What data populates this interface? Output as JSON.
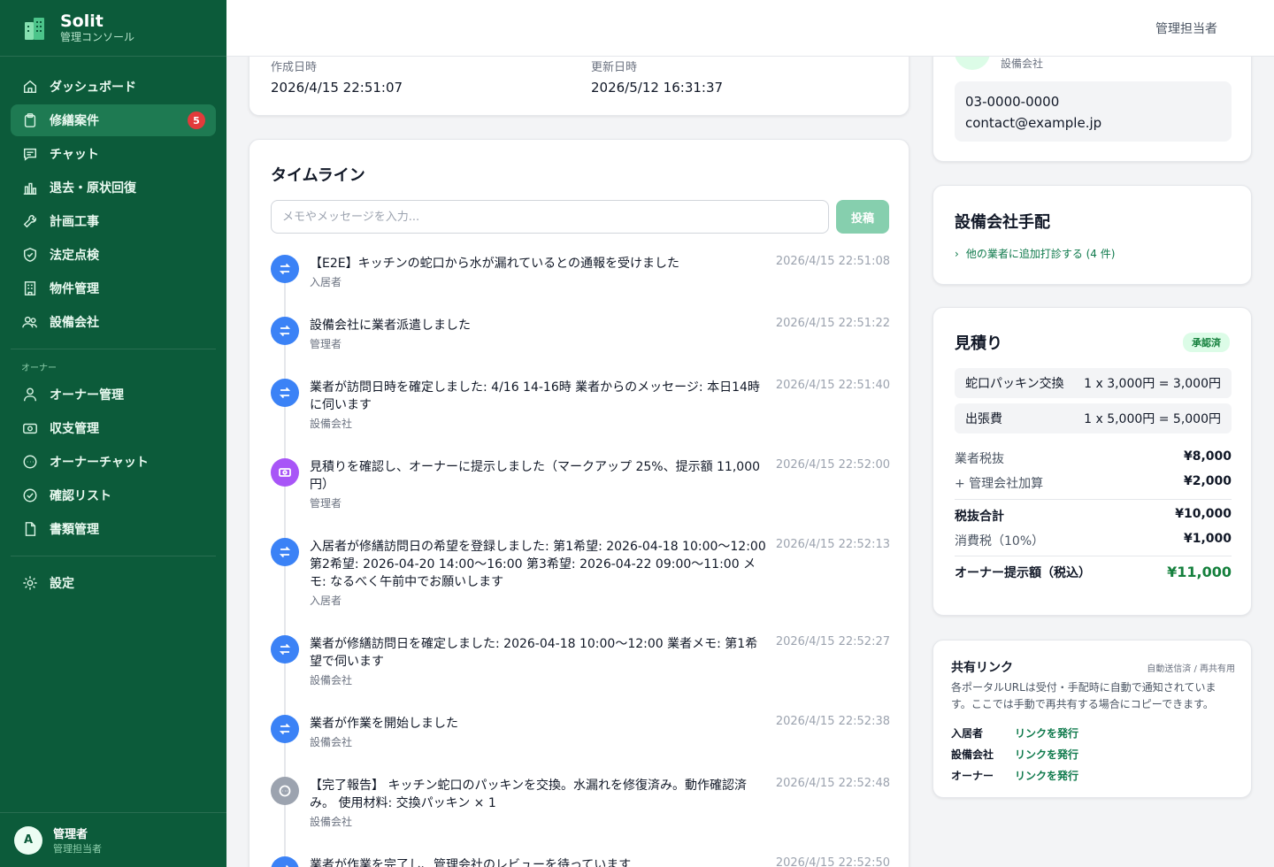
{
  "brand": {
    "title": "Solit",
    "subtitle": "管理コンソール"
  },
  "nav": {
    "items": [
      {
        "label": "ダッシュボード",
        "icon": "home-icon"
      },
      {
        "label": "修繕案件",
        "icon": "clipboard-icon",
        "badge": "5",
        "active": true
      },
      {
        "label": "チャット",
        "icon": "chat-icon"
      },
      {
        "label": "退去・原状回復",
        "icon": "building-chart-icon"
      },
      {
        "label": "計画工事",
        "icon": "wrench-icon"
      },
      {
        "label": "法定点検",
        "icon": "shield-check-icon"
      },
      {
        "label": "物件管理",
        "icon": "building-icon"
      },
      {
        "label": "設備会社",
        "icon": "users-icon"
      }
    ],
    "owner_section": "オーナー",
    "owner_items": [
      {
        "label": "オーナー管理",
        "icon": "user-icon"
      },
      {
        "label": "収支管理",
        "icon": "money-icon"
      },
      {
        "label": "オーナーチャット",
        "icon": "chat-dots-icon"
      },
      {
        "label": "確認リスト",
        "icon": "check-circle-icon"
      },
      {
        "label": "書類管理",
        "icon": "document-icon"
      }
    ],
    "settings": {
      "label": "設定",
      "icon": "gear-icon"
    }
  },
  "user": {
    "initial": "A",
    "name": "管理者",
    "role": "管理担当者"
  },
  "header": {
    "user_label": "管理担当者"
  },
  "dates": {
    "created_label": "作成日時",
    "created_value": "2026/4/15 22:51:07",
    "updated_label": "更新日時",
    "updated_value": "2026/5/12 16:31:37"
  },
  "timeline": {
    "title": "タイムライン",
    "input_placeholder": "メモやメッセージを入力...",
    "post_label": "投稿",
    "items": [
      {
        "text": "【E2E】キッチンの蛇口から水が漏れているとの通報を受けました",
        "actor": "入居者",
        "time": "2026/4/15 22:51:08",
        "kind": "blue",
        "icon": "swap-icon"
      },
      {
        "text": "設備会社に業者派遣しました",
        "actor": "管理者",
        "time": "2026/4/15 22:51:22",
        "kind": "blue",
        "icon": "swap-icon"
      },
      {
        "text": "業者が訪問日時を確定しました: 4/16 14-16時 業者からのメッセージ: 本日14時に伺います",
        "actor": "設備会社",
        "time": "2026/4/15 22:51:40",
        "kind": "blue",
        "icon": "swap-icon"
      },
      {
        "text": "見積りを確認し、オーナーに提示しました（マークアップ 25%、提示額 11,000円）",
        "actor": "管理者",
        "time": "2026/4/15 22:52:00",
        "kind": "purple",
        "icon": "money-icon"
      },
      {
        "text": "入居者が修繕訪問日の希望を登録しました: 第1希望: 2026-04-18 10:00〜12:00 第2希望: 2026-04-20 14:00〜16:00 第3希望: 2026-04-22 09:00〜11:00 メモ: なるべく午前中でお願いします",
        "actor": "入居者",
        "time": "2026/4/15 22:52:13",
        "kind": "blue",
        "icon": "swap-icon"
      },
      {
        "text": "業者が修繕訪問日を確定しました: 2026-04-18 10:00〜12:00 業者メモ: 第1希望で伺います",
        "actor": "設備会社",
        "time": "2026/4/15 22:52:27",
        "kind": "blue",
        "icon": "swap-icon"
      },
      {
        "text": "業者が作業を開始しました",
        "actor": "設備会社",
        "time": "2026/4/15 22:52:38",
        "kind": "blue",
        "icon": "swap-icon"
      },
      {
        "text": "【完了報告】 キッチン蛇口のパッキンを交換。水漏れを修復済み。動作確認済み。 使用材料: 交換パッキン × 1",
        "actor": "設備会社",
        "time": "2026/4/15 22:52:48",
        "kind": "gray",
        "icon": "chat-dots-icon"
      },
      {
        "text": "業者が作業を完了し、管理会社のレビューを待っています",
        "actor": "",
        "time": "2026/4/15 22:52:50",
        "kind": "blue",
        "icon": "swap-icon"
      }
    ]
  },
  "vendor": {
    "subtitle": "設備会社",
    "phone": "03-0000-0000",
    "email": "contact@example.jp"
  },
  "dispatch": {
    "title": "設備会社手配",
    "link": "他の業者に追加打診する (4 件)"
  },
  "estimate": {
    "title": "見積り",
    "status": "承認済",
    "lines": [
      {
        "name": "蛇口パッキン交換",
        "calc": "1 x 3,000円 = 3,000円"
      },
      {
        "name": "出張費",
        "calc": "1 x 5,000円 = 5,000円"
      }
    ],
    "vendor_pre_tax_label": "業者税抜",
    "vendor_pre_tax": "¥8,000",
    "markup_label": "+ 管理会社加算",
    "markup": "¥2,000",
    "subtotal_label": "税抜合計",
    "subtotal": "¥10,000",
    "tax_label": "消費税（10%）",
    "tax": "¥1,000",
    "total_label": "オーナー提示額（税込）",
    "total": "¥11,000"
  },
  "share": {
    "title": "共有リンク",
    "note": "自動送信済 / 再共有用",
    "desc": "各ポータルURLは受付・手配時に自動で通知されています。ここでは手動で再共有する場合にコピーできます。",
    "rows": [
      {
        "who": "入居者",
        "link": "リンクを発行"
      },
      {
        "who": "設備会社",
        "link": "リンクを発行"
      },
      {
        "who": "オーナー",
        "link": "リンクを発行"
      }
    ]
  },
  "colors": {
    "sidebar": "#0c5b3a",
    "active": "#1e7a52",
    "accent": "#15803d",
    "badge": "#e23b3b"
  }
}
